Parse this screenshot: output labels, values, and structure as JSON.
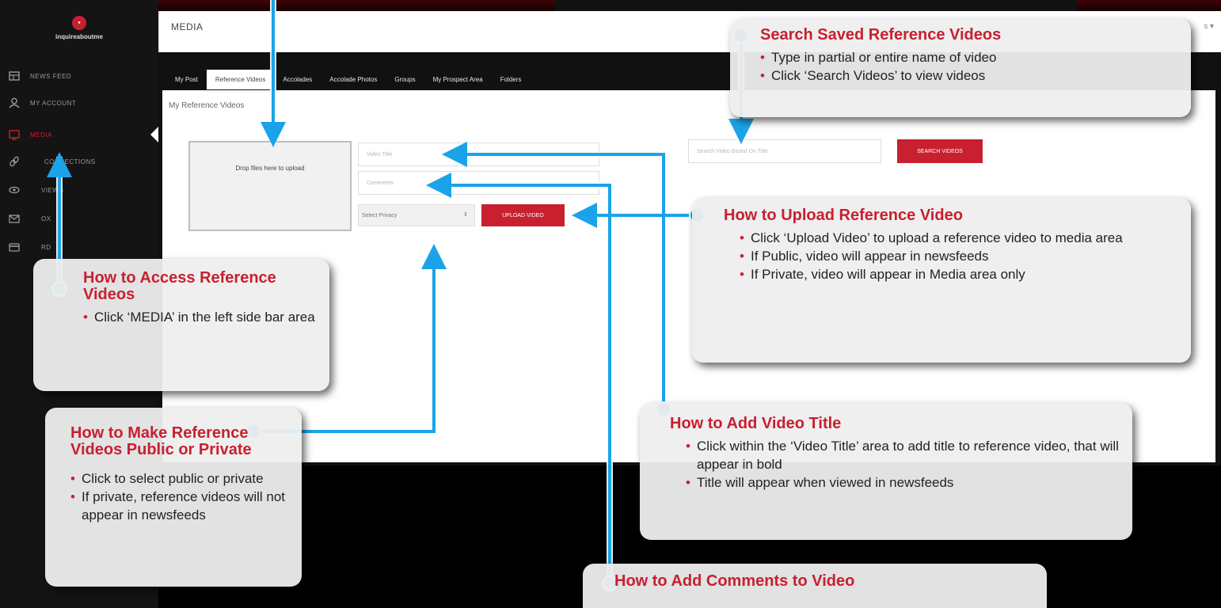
{
  "sidebar": {
    "logo_text": "inquireaboutme",
    "items": [
      {
        "label": "NEWS FEED",
        "icon": "news-feed-icon"
      },
      {
        "label": "MY ACCOUNT",
        "icon": "user-icon"
      },
      {
        "label": "MEDIA",
        "icon": "monitor-icon"
      },
      {
        "label": "CONNECTIONS",
        "icon": "link-icon"
      },
      {
        "label": "VIEWS",
        "icon": "eye-icon"
      },
      {
        "label": "OX",
        "icon": "envelope-icon"
      },
      {
        "label": "RD",
        "icon": "card-icon"
      }
    ]
  },
  "header": {
    "title": "MEDIA",
    "user": "s ▾"
  },
  "tabs": [
    "My Post",
    "Reference Videos",
    "Accolades",
    "Accolade Photos",
    "Groups",
    "My Prospect Area",
    "Folders"
  ],
  "active_tab": "Reference Videos",
  "panel": {
    "title": "My Reference Videos",
    "dropzone": "Drop files here to upload",
    "video_title_placeholder": "Video Title",
    "comments_placeholder": "Comments",
    "privacy_select": "Select Privacy",
    "upload_button": "UPLOAD VIDEO",
    "search_placeholder": "Search Video Based On Title",
    "search_button": "SEARCH VIDEOS"
  },
  "callouts": {
    "search": {
      "title": "Search Saved Reference Videos",
      "bullets": [
        "Type in partial or entire name of video",
        "Click ‘Search Videos’ to view videos"
      ]
    },
    "upload": {
      "title": "How to Upload Reference Video",
      "bullets": [
        "Click ‘Upload Video’ to upload a reference video to media area",
        "If Public, video will appear in newsfeeds",
        "If Private, video will appear in Media area only"
      ]
    },
    "access": {
      "title": "How to Access Reference Videos",
      "bullets": [
        "Click ‘MEDIA’ in the left side bar area"
      ]
    },
    "privacy": {
      "title": "How to Make Reference Videos Public or Private",
      "bullets": [
        "Click to select public or private",
        "If private, reference videos will not appear in newsfeeds"
      ]
    },
    "video_title": {
      "title": "How to Add Video Title",
      "bullets": [
        "Click within the ‘Video Title’ area to add title to reference video, that will appear in bold",
        "Title will appear when viewed in newsfeeds"
      ]
    },
    "comments": {
      "title": "How to Add Comments to Video"
    }
  },
  "colors": {
    "accent_red": "#c8202f",
    "arrow_blue": "#1aa3e8",
    "sidebar_bg": "#141414"
  }
}
